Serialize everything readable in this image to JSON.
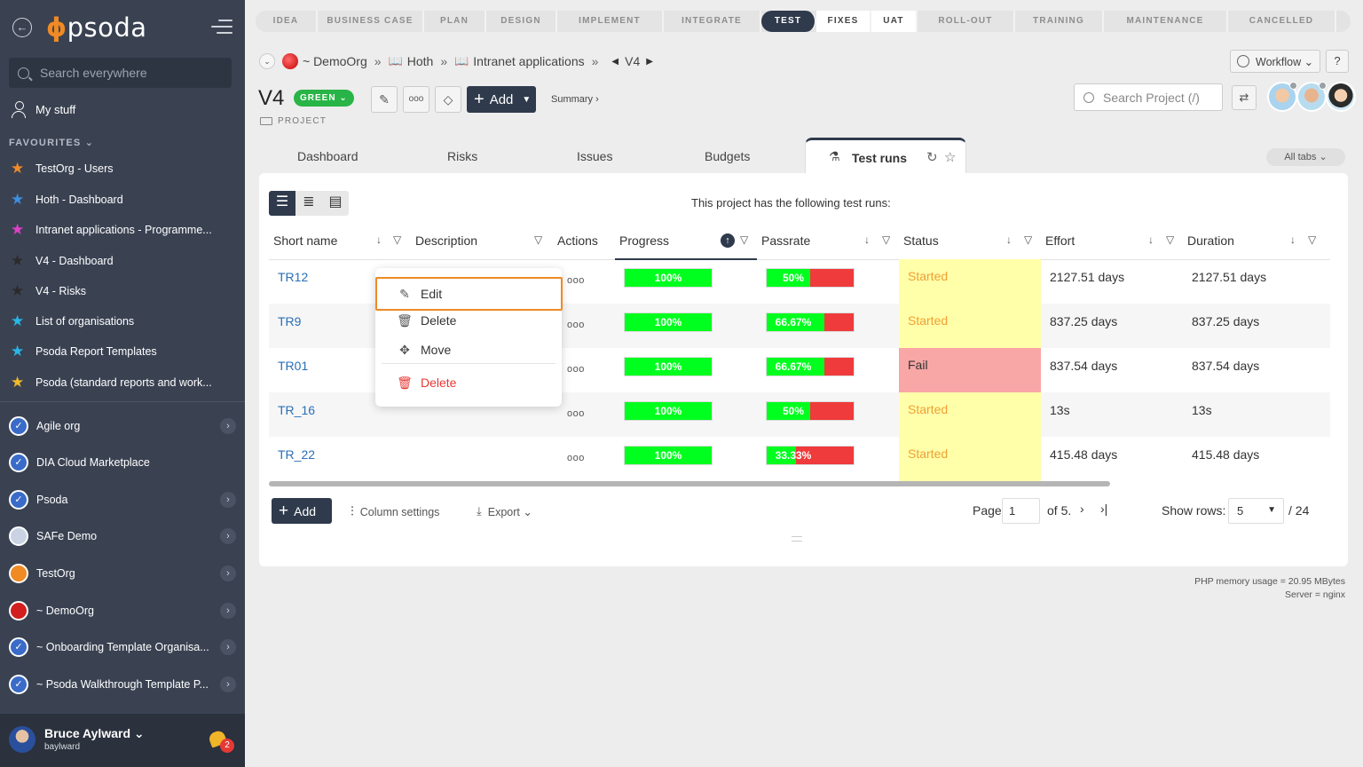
{
  "app": {
    "logo_text": "psoda",
    "logo_mark": "ɸ"
  },
  "sidebar": {
    "search_placeholder": "Search everywhere",
    "my_stuff": "My stuff",
    "favourites_header": "FAVOURITES ⌄",
    "favourites": [
      {
        "label": "TestOrg - Users",
        "star_color": "#f28a2a"
      },
      {
        "label": "Hoth - Dashboard",
        "star_color": "#3d8fe0"
      },
      {
        "label": "Intranet applications - Programme...",
        "star_color": "#e040c8"
      },
      {
        "label": "V4 - Dashboard",
        "star_color": "#2b2b2b"
      },
      {
        "label": "V4 - Risks",
        "star_color": "#2b2b2b"
      },
      {
        "label": "List of organisations",
        "star_color": "#29b6e8"
      },
      {
        "label": "Psoda Report Templates",
        "star_color": "#29b6e8"
      },
      {
        "label": "Psoda (standard reports and work...",
        "star_color": "#f2b92a"
      }
    ],
    "orgs": [
      {
        "label": "Agile org",
        "icon": "compass",
        "has_chevron": true
      },
      {
        "label": "DIA Cloud Marketplace",
        "icon": "compass",
        "has_chevron": false
      },
      {
        "label": "Psoda",
        "icon": "compass",
        "has_chevron": true
      },
      {
        "label": "SAFe Demo",
        "icon": "safe-logo",
        "has_chevron": true
      },
      {
        "label": "TestOrg",
        "icon": "orange-circle",
        "has_chevron": true
      },
      {
        "label": "~ DemoOrg",
        "icon": "red-circle",
        "has_chevron": true
      },
      {
        "label": "~ Onboarding Template Organisa...",
        "icon": "compass",
        "has_chevron": true
      },
      {
        "label": "~ Psoda Walkthrough Template P...",
        "icon": "compass",
        "has_chevron": true
      }
    ],
    "user": {
      "name": "Bruce Aylward ⌄",
      "login": "baylward",
      "notifications": "2"
    }
  },
  "phases": [
    {
      "label": "IDEA",
      "state": "todo"
    },
    {
      "label": "BUSINESS CASE",
      "state": "todo"
    },
    {
      "label": "PLAN",
      "state": "todo"
    },
    {
      "label": "DESIGN",
      "state": "todo"
    },
    {
      "label": "IMPLEMENT",
      "state": "todo"
    },
    {
      "label": "INTEGRATE",
      "state": "todo"
    },
    {
      "label": "TEST",
      "state": "active"
    },
    {
      "label": "FIXES",
      "state": "done"
    },
    {
      "label": "UAT",
      "state": "done"
    },
    {
      "label": "ROLL-OUT",
      "state": "todo"
    },
    {
      "label": "TRAINING",
      "state": "todo"
    },
    {
      "label": "MAINTENANCE",
      "state": "todo"
    },
    {
      "label": "CANCELLED",
      "state": "todo"
    }
  ],
  "breadcrumb": {
    "org": "~ DemoOrg",
    "sep": "»",
    "program": "Hoth",
    "project_group": "Intranet applications",
    "current": "V4"
  },
  "header": {
    "workflow_label": "Workflow ⌄",
    "help_label": "?",
    "title": "V4",
    "status": "GREEN ⌄",
    "type": "PROJECT",
    "add_label": "Add",
    "summary_link": "Summary ›",
    "search_placeholder": "Search Project (/)"
  },
  "tabs": {
    "items": [
      "Dashboard",
      "Risks",
      "Issues",
      "Budgets"
    ],
    "active": "Test runs",
    "all_tabs": "All tabs ⌄"
  },
  "content": {
    "intro": "This project has the following test runs:",
    "columns": {
      "short_name": "Short name",
      "description": "Description",
      "actions": "Actions",
      "progress": "Progress",
      "passrate": "Passrate",
      "status": "Status",
      "effort": "Effort",
      "duration": "Duration"
    },
    "rows": [
      {
        "name": "TR12",
        "actions": "ooo",
        "progress_label": "100%",
        "progress": 100,
        "pass_label": "50%",
        "pass": 50,
        "status": "Started",
        "effort": "2127.51 days",
        "duration": "2127.51 days"
      },
      {
        "name": "TR9",
        "actions": "ooo",
        "progress_label": "100%",
        "progress": 100,
        "pass_label": "66.67%",
        "pass": 66.67,
        "status": "Started",
        "effort": "837.25 days",
        "duration": "837.25 days"
      },
      {
        "name": "TR01",
        "actions": "ooo",
        "progress_label": "100%",
        "progress": 100,
        "pass_label": "66.67%",
        "pass": 66.67,
        "status": "Fail",
        "effort": "837.54 days",
        "duration": "837.54 days"
      },
      {
        "name": "TR_16",
        "actions": "ooo",
        "progress_label": "100%",
        "progress": 100,
        "pass_label": "50%",
        "pass": 50,
        "status": "Started",
        "effort": "13s",
        "duration": "13s"
      },
      {
        "name": "TR_22",
        "actions": "ooo",
        "progress_label": "100%",
        "progress": 100,
        "pass_label": "33.33%",
        "pass": 33.33,
        "status": "Started",
        "effort": "415.48 days",
        "duration": "415.48 days"
      }
    ],
    "context_menu": {
      "edit": "Edit",
      "delete": "Delete",
      "move": "Move",
      "delete_danger": "Delete"
    },
    "table_footer": {
      "add": "Add",
      "column_settings": "Column settings",
      "export": "Export ⌄",
      "page_label": "Page",
      "page_value": "1",
      "page_of": "of 5.",
      "next": "›",
      "last": "›|",
      "show_rows_label": "Show rows:",
      "show_rows_value": "5",
      "total": "/ 24"
    }
  },
  "footer": {
    "memory": "PHP memory usage = 20.95 MBytes",
    "server": "Server = nginx"
  },
  "colors": {
    "sidebar_bg": "#3a4252",
    "accent_dark": "#2f3a4c",
    "accent_orange": "#f08a24",
    "progress_green": "#00ff1e",
    "fail_red": "#ef3b3b",
    "status_started_bg": "#ffffaa",
    "status_fail_bg": "#f9a6a6"
  }
}
